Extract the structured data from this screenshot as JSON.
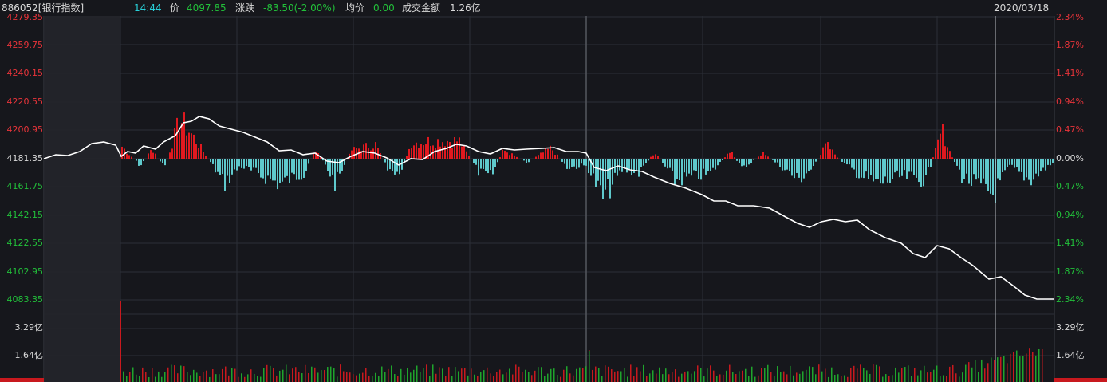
{
  "header": {
    "code": "886052[银行指数]",
    "time": "14:44",
    "price_label": "价",
    "price": "4097.85",
    "change_label": "涨跌",
    "change": "-83.50(-2.00%)",
    "avg_label": "均价",
    "avg": "0.00",
    "amount_label": "成交金额",
    "amount": "1.26亿",
    "date": "2020/03/18"
  },
  "price_axis": {
    "left": [
      "4279.35",
      "4259.75",
      "4240.15",
      "4220.55",
      "4200.95",
      "4181.35",
      "4161.75",
      "4142.15",
      "4122.55",
      "4102.95",
      "4083.35"
    ],
    "right": [
      "2.34%",
      "1.87%",
      "1.41%",
      "0.94%",
      "0.47%",
      "0.00%",
      "0.47%",
      "0.94%",
      "1.41%",
      "1.87%",
      "2.34%"
    ]
  },
  "volume_axis": {
    "left": [
      "3.29亿",
      "1.64亿"
    ],
    "right": [
      "3.29亿",
      "1.64亿"
    ]
  },
  "colors": {
    "up": "#e0191f",
    "down": "#5fc9cc",
    "line": "#ffffff",
    "grid": "#2c2f37",
    "vol_green": "#1fa52c",
    "vol_red": "#c8191e"
  }
}
